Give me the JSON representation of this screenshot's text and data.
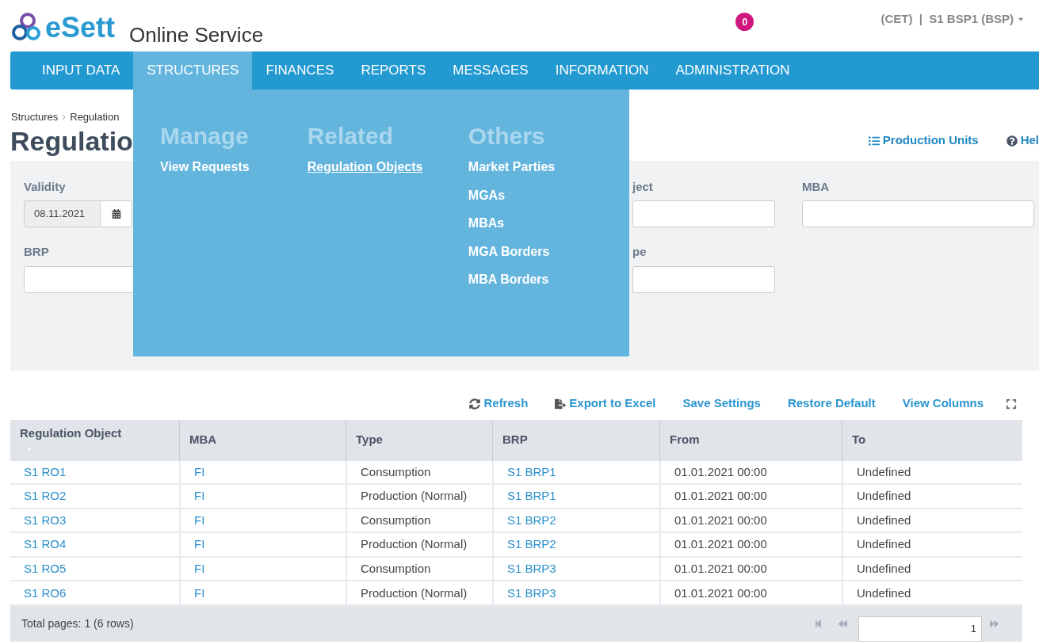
{
  "header": {
    "logo_text": "eSett",
    "app_title": "Online Service",
    "notification_count": "0",
    "user_text": "(CET)  |  S1 BSP1 (BSP)"
  },
  "nav": [
    {
      "label": "INPUT DATA",
      "selected": false
    },
    {
      "label": "STRUCTURES",
      "selected": true
    },
    {
      "label": "FINANCES",
      "selected": false
    },
    {
      "label": "REPORTS",
      "selected": false
    },
    {
      "label": "MESSAGES",
      "selected": false
    },
    {
      "label": "INFORMATION",
      "selected": false
    },
    {
      "label": "ADMINISTRATION",
      "selected": false
    }
  ],
  "dropdown": {
    "columns": [
      {
        "heading": "Manage",
        "items": [
          {
            "label": "View Requests",
            "selected": false
          }
        ]
      },
      {
        "heading": "Related",
        "items": [
          {
            "label": "Regulation Objects",
            "selected": true
          }
        ]
      },
      {
        "heading": "Others",
        "items": [
          {
            "label": "Market Parties",
            "selected": false
          },
          {
            "label": "MGAs",
            "selected": false
          },
          {
            "label": "MBAs",
            "selected": false
          },
          {
            "label": "MGA Borders",
            "selected": false
          },
          {
            "label": "MBA Borders",
            "selected": false
          }
        ]
      }
    ]
  },
  "breadcrumb": [
    "Structures",
    "Regulation"
  ],
  "page_title": "Regulatio",
  "page_actions": [
    {
      "label": "Production Units",
      "kind": "list"
    },
    {
      "label": "Hel",
      "kind": "help"
    }
  ],
  "filters": {
    "validity": {
      "label": "Validity",
      "value": "08.11.2021"
    },
    "brp": {
      "label": "BRP"
    },
    "object": {
      "label": "ject"
    },
    "type": {
      "label": "pe"
    },
    "mba": {
      "label": "MBA"
    }
  },
  "toolbar": [
    {
      "label": "Refresh",
      "kind": "refresh"
    },
    {
      "label": "Export to Excel",
      "kind": "export"
    },
    {
      "label": "Save Settings",
      "kind": "plain"
    },
    {
      "label": "Restore Default",
      "kind": "plain"
    },
    {
      "label": "View Columns",
      "kind": "plain"
    }
  ],
  "table": {
    "columns": [
      {
        "label": "Regulation Object",
        "kind": "link",
        "sorted": true
      },
      {
        "label": "MBA",
        "kind": "link",
        "sorted": false
      },
      {
        "label": "Type",
        "kind": "text",
        "sorted": false
      },
      {
        "label": "BRP",
        "kind": "link",
        "sorted": false
      },
      {
        "label": "From",
        "kind": "text",
        "sorted": false
      },
      {
        "label": "To",
        "kind": "text",
        "sorted": false
      }
    ],
    "rows": [
      [
        "S1 RO1",
        "FI",
        "Consumption",
        "S1 BRP1",
        "01.01.2021 00:00",
        "Undefined"
      ],
      [
        "S1 RO2",
        "FI",
        "Production (Normal)",
        "S1 BRP1",
        "01.01.2021 00:00",
        "Undefined"
      ],
      [
        "S1 RO3",
        "FI",
        "Consumption",
        "S1 BRP2",
        "01.01.2021 00:00",
        "Undefined"
      ],
      [
        "S1 RO4",
        "FI",
        "Production (Normal)",
        "S1 BRP2",
        "01.01.2021 00:00",
        "Undefined"
      ],
      [
        "S1 RO5",
        "FI",
        "Consumption",
        "S1 BRP3",
        "01.01.2021 00:00",
        "Undefined"
      ],
      [
        "S1 RO6",
        "FI",
        "Production (Normal)",
        "S1 BRP3",
        "01.01.2021 00:00",
        "Undefined"
      ]
    ]
  },
  "footer": {
    "summary": "Total pages: 1 (6 rows)",
    "page": "1"
  }
}
